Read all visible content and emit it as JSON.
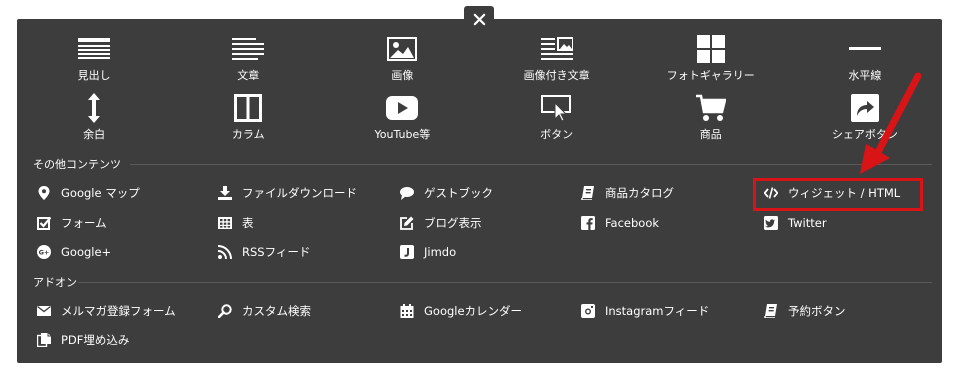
{
  "close_label": "×",
  "top_items": [
    {
      "name": "tile-heading",
      "icon": "heading-icon",
      "label": "見出し"
    },
    {
      "name": "tile-text",
      "icon": "text-icon",
      "label": "文章"
    },
    {
      "name": "tile-image",
      "icon": "image-icon",
      "label": "画像"
    },
    {
      "name": "tile-image-text",
      "icon": "image-text-icon",
      "label": "画像付き文章"
    },
    {
      "name": "tile-photo-gallery",
      "icon": "gallery-icon",
      "label": "フォトギャラリー"
    },
    {
      "name": "tile-horizontal-line",
      "icon": "horizontal-line-icon",
      "label": "水平線"
    },
    {
      "name": "tile-spacer",
      "icon": "spacer-icon",
      "label": "余白"
    },
    {
      "name": "tile-columns",
      "icon": "columns-icon",
      "label": "カラム"
    },
    {
      "name": "tile-youtube",
      "icon": "youtube-icon",
      "label": "YouTube等"
    },
    {
      "name": "tile-button",
      "icon": "button-icon",
      "label": "ボタン"
    },
    {
      "name": "tile-product",
      "icon": "cart-icon",
      "label": "商品"
    },
    {
      "name": "tile-share-button",
      "icon": "share-icon",
      "label": "シェアボタン"
    }
  ],
  "other_section": {
    "title": "その他コンテンツ",
    "items": [
      {
        "name": "item-google-map",
        "icon": "map-pin-icon",
        "label": "Google マップ"
      },
      {
        "name": "item-file-download",
        "icon": "download-icon",
        "label": "ファイルダウンロード"
      },
      {
        "name": "item-guestbook",
        "icon": "chat-bubble-icon",
        "label": "ゲストブック"
      },
      {
        "name": "item-product-catalog",
        "icon": "book-icon",
        "label": "商品カタログ"
      },
      {
        "name": "item-widget-html",
        "icon": "code-icon",
        "label": "ウィジェット / HTML"
      },
      {
        "name": "item-form",
        "icon": "checkbox-icon",
        "label": "フォーム"
      },
      {
        "name": "item-table",
        "icon": "table-icon",
        "label": "表"
      },
      {
        "name": "item-blog-display",
        "icon": "edit-icon",
        "label": "ブログ表示"
      },
      {
        "name": "item-facebook",
        "icon": "facebook-icon",
        "label": "Facebook"
      },
      {
        "name": "item-twitter",
        "icon": "twitter-icon",
        "label": "Twitter"
      },
      {
        "name": "item-google-plus",
        "icon": "google-plus-icon",
        "label": "Google+"
      },
      {
        "name": "item-rss-feed",
        "icon": "rss-icon",
        "label": "RSSフィード"
      },
      {
        "name": "item-jimdo",
        "icon": "jimdo-icon",
        "label": "Jimdo"
      }
    ]
  },
  "addon_section": {
    "title": "アドオン",
    "items": [
      {
        "name": "item-mail-magazine",
        "icon": "mail-icon",
        "label": "メルマガ登録フォーム"
      },
      {
        "name": "item-custom-search",
        "icon": "search-icon",
        "label": "カスタム検索"
      },
      {
        "name": "item-google-calendar",
        "icon": "calendar-icon",
        "label": "Googleカレンダー"
      },
      {
        "name": "item-instagram-feed",
        "icon": "instagram-icon",
        "label": "Instagramフィード"
      },
      {
        "name": "item-reservation-button",
        "icon": "book-icon",
        "label": "予約ボタン"
      },
      {
        "name": "item-pdf-embed",
        "icon": "pdf-icon",
        "label": "PDF埋め込み"
      }
    ]
  },
  "colors": {
    "panel_bg": "#3d3d3d",
    "text": "#ffffff",
    "highlight": "#d81416"
  }
}
